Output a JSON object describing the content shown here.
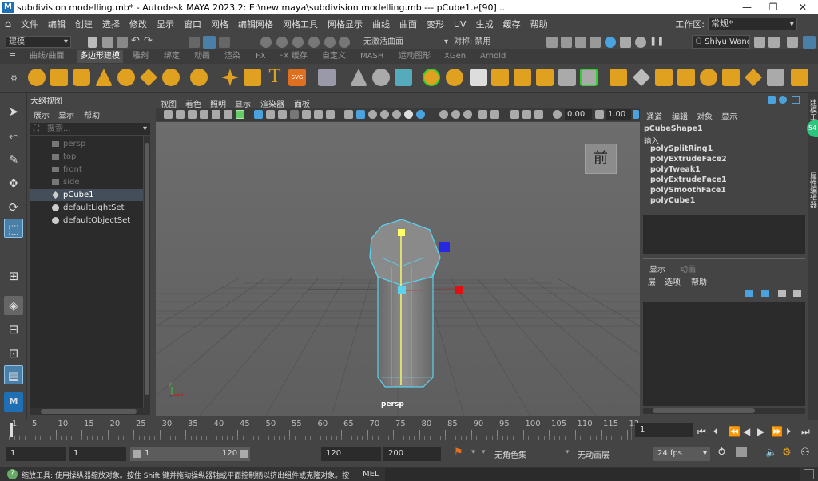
{
  "window": {
    "title": "subdivision modelling.mb* - Autodesk MAYA 2023.2: E:\\new maya\\subdivision modelling.mb   ---   pCube1.e[90]...",
    "controls": [
      "—",
      "❐",
      "✕"
    ]
  },
  "menubar": {
    "items": [
      "文件",
      "编辑",
      "创建",
      "选择",
      "修改",
      "显示",
      "窗口",
      "网格",
      "编辑网格",
      "网格工具",
      "网格显示",
      "曲线",
      "曲面",
      "变形",
      "UV",
      "生成",
      "缓存",
      "帮助"
    ],
    "workspace_label": "工作区:",
    "workspace_value": "常规*"
  },
  "statusline": {
    "mode": "建模",
    "live_surface": "无激活曲面",
    "symmetry": "对称: 禁用",
    "user": "Shiyu Wang"
  },
  "shelf": {
    "tabs": [
      "曲线/曲面",
      "多边形建模",
      "雕刻",
      "绑定",
      "动画",
      "渲染",
      "FX",
      "FX 缓存",
      "自定义",
      "MASH",
      "运动图形",
      "XGen",
      "Arnold"
    ],
    "active_tab": "多边形建模",
    "text_icon": "T",
    "svg_icon": "SVG"
  },
  "outliner": {
    "title": "大纲视图",
    "menu": [
      "展示",
      "显示",
      "帮助"
    ],
    "search_placeholder": "搜索...",
    "items": [
      {
        "label": "persp",
        "dim": true
      },
      {
        "label": "top",
        "dim": true
      },
      {
        "label": "front",
        "dim": true
      },
      {
        "label": "side",
        "dim": true
      },
      {
        "label": "pCube1",
        "selected": true
      },
      {
        "label": "defaultLightSet"
      },
      {
        "label": "defaultObjectSet"
      }
    ]
  },
  "viewport": {
    "menu": [
      "视图",
      "着色",
      "照明",
      "显示",
      "渲染器",
      "面板"
    ],
    "value1": "0.00",
    "value2": "1.00",
    "camera_label": "persp",
    "view_cube": "前",
    "axis_x": "x",
    "axis_y": "y"
  },
  "channelbox": {
    "menu": [
      "通道",
      "编辑",
      "对象",
      "显示"
    ],
    "shape": "pCubeShape1",
    "inputs_label": "输入",
    "inputs": [
      "polySplitRing1",
      "polyExtrudeFace2",
      "polyTweak1",
      "polyExtrudeFace1",
      "polySmoothFace1",
      "polyCube1"
    ],
    "layer_tabs": [
      "显示",
      "动画"
    ],
    "layer_menu": [
      "层",
      "选项",
      "帮助"
    ]
  },
  "rightstrip": {
    "labels": [
      "建模工具包",
      "属性编辑器"
    ]
  },
  "timeslider": {
    "ticks": [
      "1",
      "5",
      "10",
      "15",
      "20",
      "25",
      "30",
      "35",
      "40",
      "45",
      "50",
      "55",
      "60",
      "65",
      "70",
      "75",
      "80",
      "85",
      "90",
      "95",
      "100",
      "105",
      "110",
      "115",
      "12"
    ],
    "current_frame": "1"
  },
  "rangeslider": {
    "start": "1",
    "playback_start": "1",
    "range_start": "1",
    "range_end": "120",
    "playback_end": "120",
    "end": "200",
    "character_set": "无角色集",
    "anim_layer": "无动画层",
    "fps": "24 fps"
  },
  "cmdline": {
    "help": "缩放工具: 使用操纵器缩放对象。按住 Shift 键并拖动操纵器轴或平面控制柄以挤出组件或克隆对象。按住",
    "mel": "MEL"
  },
  "colors": {
    "accent_blue": "#4aa3df",
    "selected_yellow": "#ffff66",
    "manip_red": "#e01010",
    "manip_blue": "#2828e0",
    "manip_cyan": "#5ad2f0"
  }
}
